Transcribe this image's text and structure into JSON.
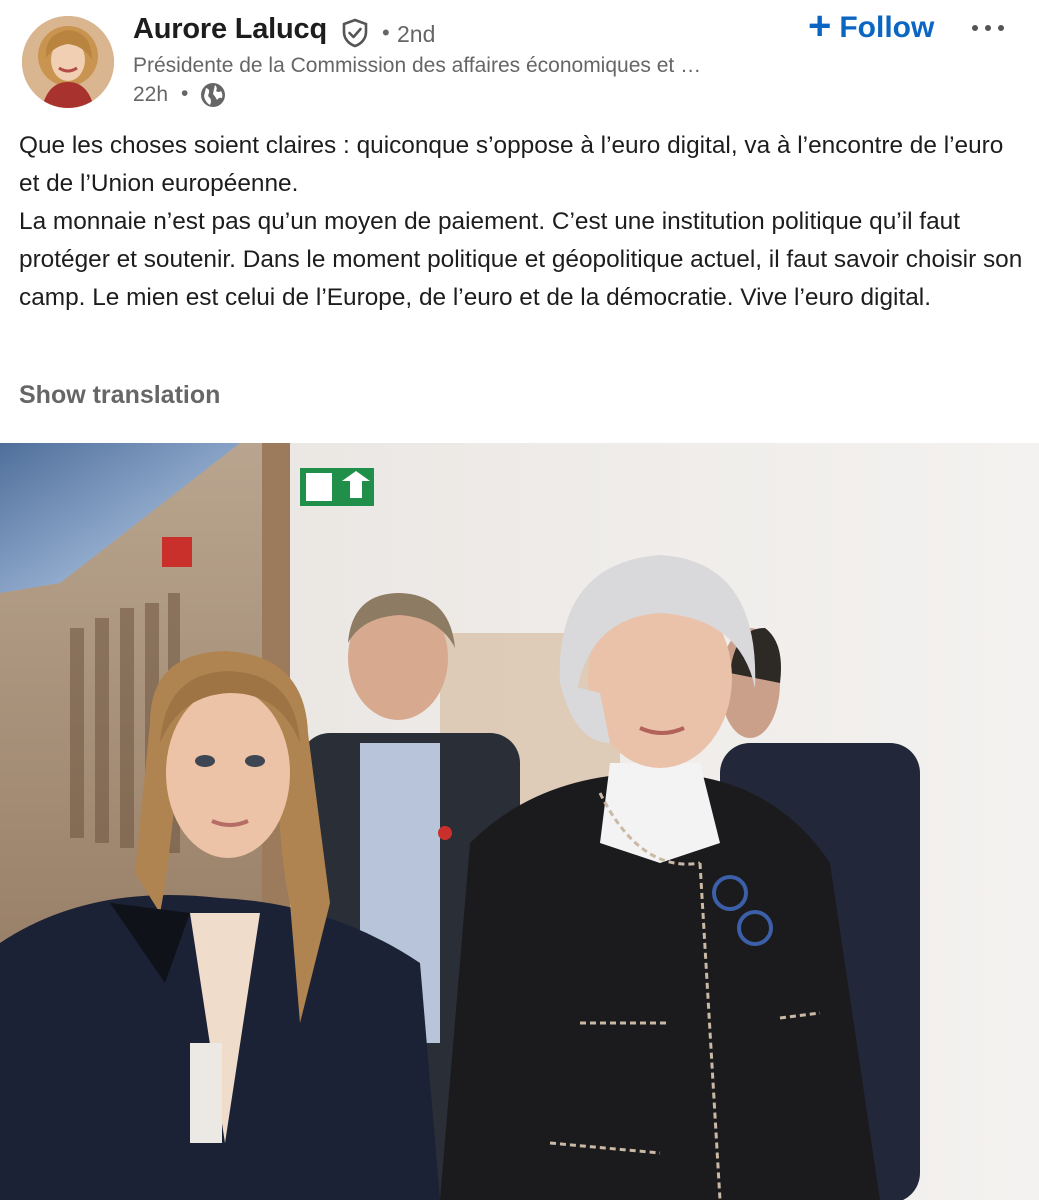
{
  "author": {
    "name": "Aurore Lalucq",
    "degree": "2nd",
    "headline": "Présidente de la Commission des affaires économiques et …",
    "time": "22h",
    "verified_icon": "verified-shield-icon",
    "visibility_icon": "globe-icon"
  },
  "actions": {
    "follow_label": "Follow",
    "follow_icon": "plus-icon",
    "more_icon": "more-horizontal-icon"
  },
  "post": {
    "paragraphs": [
      "Que les choses soient claires : quiconque s’oppose à l’euro digital, va à l’encontre de l’euro et de l’Union européenne.",
      "La monnaie n’est pas qu’un moyen de paiement. C’est une institution politique qu’il faut protéger et soutenir. Dans le moment politique et géopolitique actuel, il faut savoir choisir son camp. Le mien est celui de l’Europe, de l’euro et de la démocratie. Vive l’euro digital."
    ],
    "show_translation": "Show translation"
  },
  "colors": {
    "accent": "#0a66c2",
    "muted_text": "#666666",
    "text": "#1d1d1d"
  }
}
